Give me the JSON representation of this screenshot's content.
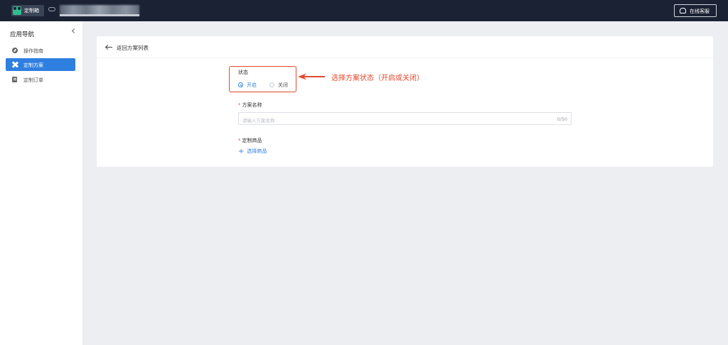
{
  "topbar": {
    "app_name": "定制箱",
    "support_label": "在线客服"
  },
  "sidebar": {
    "title": "应用导航",
    "items": [
      {
        "label": "操作指南",
        "icon": "compass-icon",
        "active": false
      },
      {
        "label": "定制方案",
        "icon": "cross-tools-icon",
        "active": true
      },
      {
        "label": "定制订单",
        "icon": "document-icon",
        "active": false
      }
    ]
  },
  "page": {
    "back_label": "返回方案列表",
    "status": {
      "label": "状态",
      "options": [
        "开启",
        "关闭"
      ],
      "selected": "开启"
    },
    "name_field": {
      "required_mark": "*",
      "label": "方案名称",
      "placeholder": "请输入方案名称",
      "counter": "0/50"
    },
    "goods_field": {
      "required_mark": "*",
      "label": "定制商品",
      "add_label": "选择商品"
    }
  },
  "annotation": {
    "text": "选择方案状态（开启或关闭）",
    "color": "#e04a2f"
  },
  "colors": {
    "accent": "#2f7fe0",
    "topbar": "#1b2233",
    "annotation": "#e04a2f"
  }
}
